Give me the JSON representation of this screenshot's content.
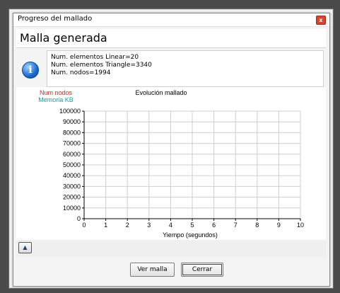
{
  "window": {
    "title": "Progreso del mallado",
    "close_label": "x"
  },
  "header": {
    "title": "Malla generada"
  },
  "info": {
    "icon": "info-icon",
    "icon_glyph": "i",
    "lines": [
      "Num. elementos Linear=20",
      "Num. elementos Triangle=3340",
      "Num. nodos=1994"
    ]
  },
  "chart_data": {
    "type": "line",
    "title": "Evolución mallado",
    "legend": [
      {
        "name": "Num nodos",
        "color": "#d12b2b"
      },
      {
        "name": "Memoria KB",
        "color": "#1f9a9a"
      }
    ],
    "legend_position": "top-left",
    "xlabel": "Yiempo (segundos)",
    "ylabel": "",
    "xlim": [
      0,
      10
    ],
    "ylim": [
      0,
      100000
    ],
    "xticks": [
      "0",
      "1",
      "2",
      "3",
      "4",
      "5",
      "6",
      "7",
      "8",
      "9",
      "10"
    ],
    "yticks": [
      "0",
      "10000",
      "20000",
      "30000",
      "40000",
      "50000",
      "60000",
      "70000",
      "80000",
      "90000",
      "100000"
    ],
    "grid": true,
    "series": [
      {
        "name": "Num nodos",
        "x": [],
        "y": []
      },
      {
        "name": "Memoria KB",
        "x": [],
        "y": []
      }
    ]
  },
  "footer": {
    "expand_icon": "chevron-up-icon",
    "expand_glyph": "▲",
    "view_mesh_label": "Ver malla",
    "close_label": "Cerrar"
  }
}
